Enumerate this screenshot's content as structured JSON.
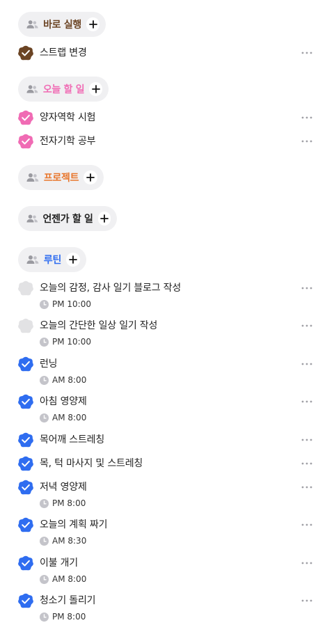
{
  "colors": {
    "brown": "#6b4424",
    "pink": "#f06bb4",
    "orange": "#e8772e",
    "dark": "#1f1f1f",
    "blue": "#2f6df0",
    "unchecked": "#e2e2e4",
    "chip_bg": "#f0f0f2"
  },
  "groups": {
    "quick_run": {
      "title": "바로 실행",
      "items": [
        {
          "title": "스트랩 변경"
        }
      ]
    },
    "today": {
      "title": "오늘 할 일",
      "items": [
        {
          "title": "양자역학 시험"
        },
        {
          "title": "전자기학 공부"
        }
      ]
    },
    "project": {
      "title": "프로젝트"
    },
    "someday": {
      "title": "언젠가 할 일"
    },
    "routine": {
      "title": "루틴",
      "items": [
        {
          "title": "오늘의 감정, 감사 일기 블로그 작성",
          "time": "PM 10:00",
          "done": false
        },
        {
          "title": "오늘의 간단한 일상 일기 작성",
          "time": "PM 10:00",
          "done": false
        },
        {
          "title": "런닝",
          "time": "AM 8:00",
          "done": true
        },
        {
          "title": "아침 영양제",
          "time": "AM 8:00",
          "done": true
        },
        {
          "title": "목어깨 스트레칭",
          "done": true
        },
        {
          "title": "목, 턱 마사지 및 스트레칭",
          "done": true
        },
        {
          "title": "저녁 영양제",
          "time": "PM 8:00",
          "done": true
        },
        {
          "title": "오늘의 계획 짜기",
          "time": "AM 8:30",
          "done": true
        },
        {
          "title": "이불 개기",
          "time": "AM 8:00",
          "done": true
        },
        {
          "title": "청소기 돌리기",
          "time": "PM 8:00",
          "done": true
        }
      ]
    }
  }
}
